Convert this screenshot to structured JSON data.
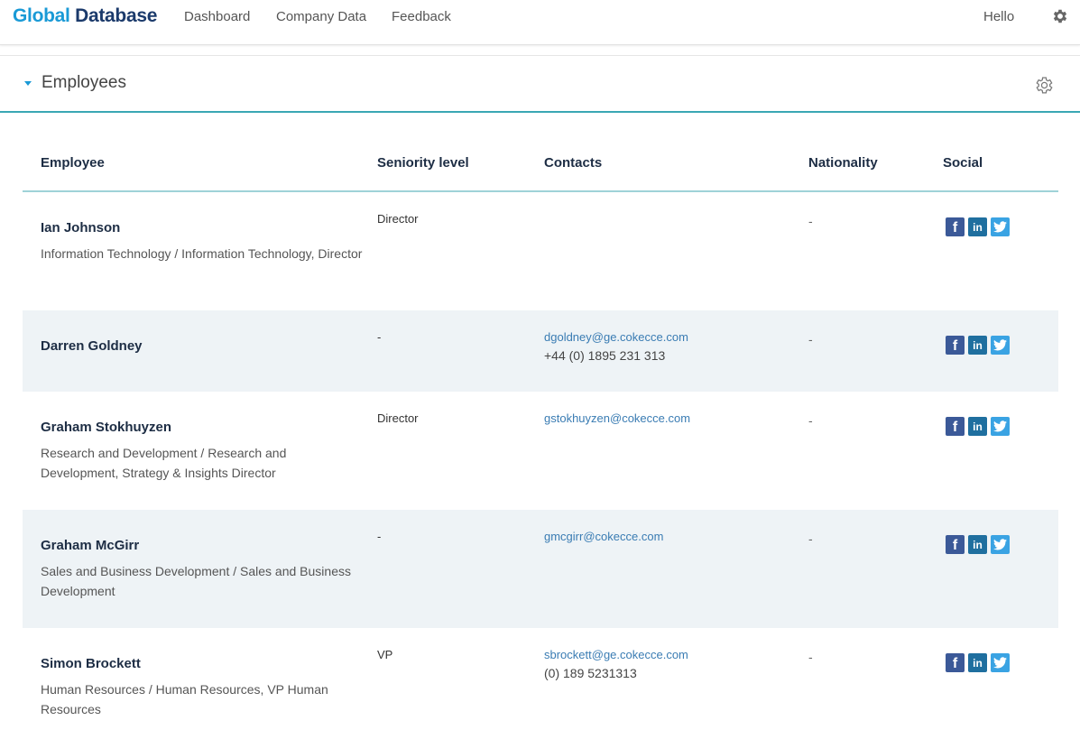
{
  "app": {
    "logo_part1": "Global",
    "logo_part2": "Database"
  },
  "nav": {
    "links": [
      "Dashboard",
      "Company Data",
      "Feedback"
    ],
    "greeting": "Hello"
  },
  "section": {
    "title": "Employees"
  },
  "table": {
    "headers": [
      "Employee",
      "Seniority level",
      "Contacts",
      "Nationality",
      "Social"
    ],
    "rows": [
      {
        "name": "Ian Johnson",
        "dept": "Information Technology / Information Technology, Director",
        "seniority": "Director",
        "email": "",
        "phone": "",
        "nationality": "-"
      },
      {
        "name": "Darren Goldney",
        "dept": "",
        "seniority": "-",
        "email": "dgoldney@ge.cokecce.com",
        "phone": "+44 (0) 1895 231 313",
        "nationality": "-"
      },
      {
        "name": "Graham Stokhuyzen",
        "dept": "Research and Development / Research and Development, Strategy & Insights Director",
        "seniority": "Director",
        "email": "gstokhuyzen@cokecce.com",
        "phone": "",
        "nationality": "-"
      },
      {
        "name": "Graham McGirr",
        "dept": "Sales and Business Development / Sales and Business Development",
        "seniority": "-",
        "email": "gmcgirr@cokecce.com",
        "phone": "",
        "nationality": "-"
      },
      {
        "name": "Simon Brockett",
        "dept": "Human Resources / Human Resources, VP Human Resources",
        "seniority": "VP",
        "email": "sbrockett@ge.cokecce.com",
        "phone": "(0) 189 5231313",
        "nationality": "-"
      }
    ]
  },
  "icons": {
    "facebook": "facebook-icon",
    "linkedin": "linkedin-icon",
    "twitter": "twitter-icon",
    "settings": "gear-icon"
  },
  "colors": {
    "brand_light": "#1a9ad6",
    "brand_dark": "#1b3a6b",
    "accent_line": "#3aa7b4",
    "link": "#3a7cb3",
    "row_alt": "#eef3f6"
  }
}
